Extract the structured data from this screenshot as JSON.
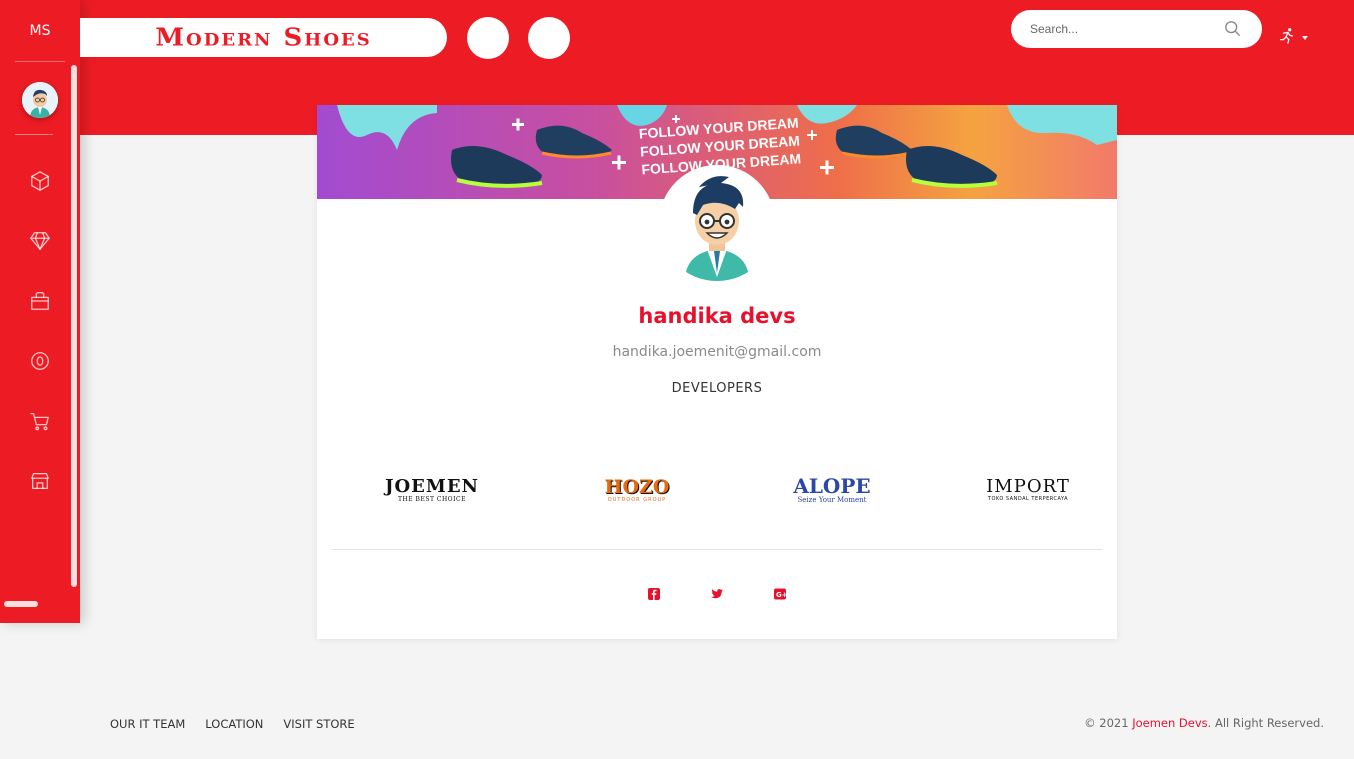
{
  "colors": {
    "brand_red": "#ed1c24",
    "accent_red": "#e8112d",
    "card_bg": "#ffffff",
    "page_bg": "#f4f4f4"
  },
  "sidebar": {
    "brand": "MS",
    "items": [
      {
        "name": "box-icon"
      },
      {
        "name": "diamond-icon"
      },
      {
        "name": "shopping-bag-icon"
      },
      {
        "name": "zero-circle-icon"
      },
      {
        "name": "cart-icon"
      },
      {
        "name": "store-icon"
      }
    ]
  },
  "header": {
    "logo_text": "Modern Shoes",
    "search": {
      "placeholder": "Search...",
      "icon": "search-icon"
    },
    "user_menu_icon": "runner-icon"
  },
  "banner": {
    "headline": "FOLLOW YOUR DREAM",
    "headline_lines": [
      "FOLLOW YOUR DREAM",
      "FOLLOW YOUR DREAM",
      "FOLLOW YOUR DREAM"
    ]
  },
  "profile": {
    "name": "handika devs",
    "email": "handika.joemenit@gmail.com",
    "role": "DEVELOPERS"
  },
  "brands": [
    {
      "name": "JOEMEN",
      "tagline": "THE BEST CHOICE"
    },
    {
      "name": "HOZO",
      "tagline": "OUTDOOR GROUP"
    },
    {
      "name": "ALOPE",
      "tagline": "Seize Your Moment"
    },
    {
      "name": "IMPORT",
      "tagline": "TOKO SANDAL TERPERCAYA"
    }
  ],
  "social": [
    "facebook-icon",
    "twitter-icon",
    "google-plus-icon"
  ],
  "footer": {
    "links": [
      "OUR IT TEAM",
      "LOCATION",
      "VISIT STORE"
    ],
    "copyright_prefix": "© 2021 ",
    "copyright_link": "Joemen Devs",
    "copyright_suffix": ". All Right Reserved."
  }
}
